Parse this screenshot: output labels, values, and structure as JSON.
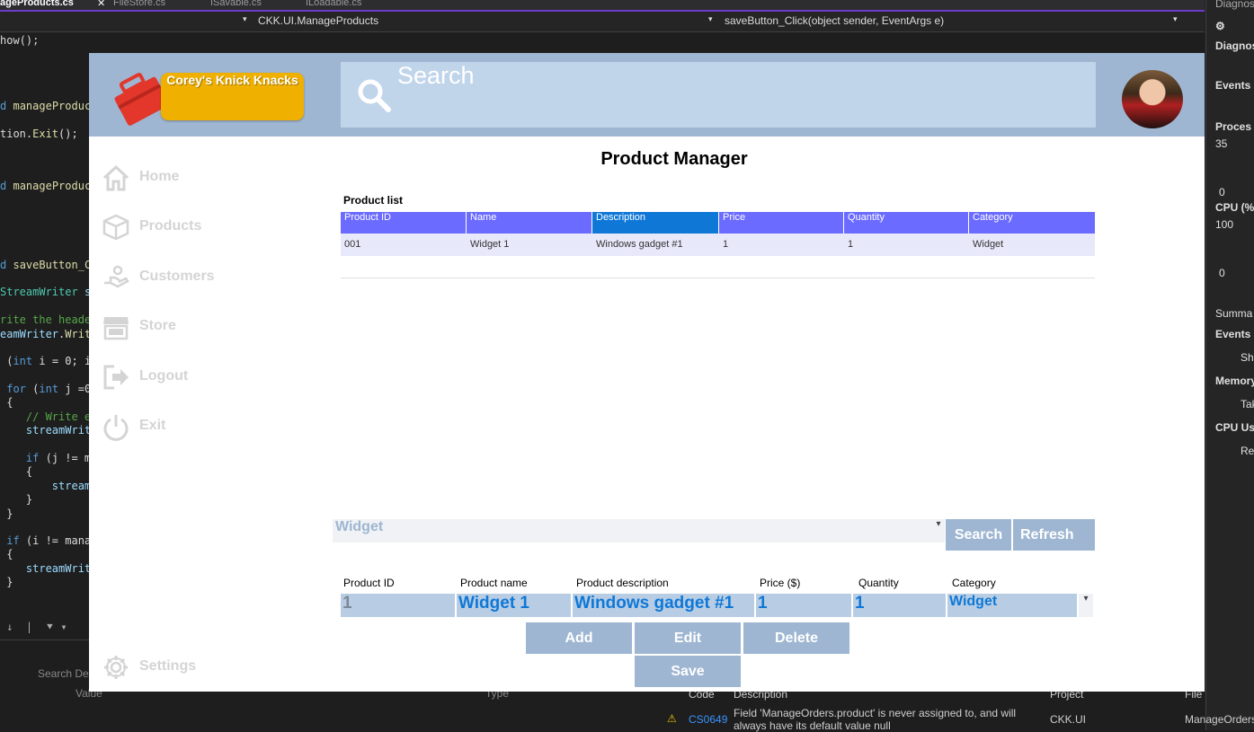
{
  "ide": {
    "tabs": [
      "ageProducts.cs",
      "FileStore.cs",
      "ISavable.cs",
      "ILoadable.cs"
    ],
    "nav_class": "CKK.UI.ManageProducts",
    "nav_member": "saveButton_Click(object sender, EventArgs e)",
    "diag_title": "Diagnost",
    "diag_labels": [
      "Diagnos",
      "Events",
      "Proces",
      "35",
      "0",
      "CPU (%",
      "100",
      "0",
      "Summa",
      "Events",
      "Sho",
      "Memory",
      "Tak",
      "CPU Us",
      "Rec"
    ],
    "bottom": {
      "search": "Search Dep",
      "value_header": "Value",
      "type_header": "Type",
      "code_header": "Code",
      "desc_header": "Description",
      "project_header": "Project",
      "file_header": "File",
      "error_code": "CS0649",
      "error_desc": "Field 'ManageOrders.product' is never assigned to, and will always have its default value null",
      "error_project": "CKK.UI",
      "error_file": "ManageOrders"
    }
  },
  "app": {
    "logo_text": "Corey's Knick Knacks",
    "search_placeholder": "Search",
    "nav": [
      {
        "label": "Home",
        "icon": "home-icon"
      },
      {
        "label": "Products",
        "icon": "box-icon"
      },
      {
        "label": "Customers",
        "icon": "hand-icon"
      },
      {
        "label": "Store",
        "icon": "store-icon"
      },
      {
        "label": "Logout",
        "icon": "logout-icon"
      },
      {
        "label": "Exit",
        "icon": "power-icon"
      }
    ],
    "settings_label": "Settings",
    "title": "Product Manager",
    "list_caption": "Product list",
    "grid_headers": [
      "Product ID",
      "Name",
      "Description",
      "Price",
      "Quantity",
      "Category"
    ],
    "grid_rows": [
      [
        "001",
        "Widget 1",
        "Windows gadget #1",
        "1",
        "1",
        "Widget"
      ]
    ],
    "filter_value": "Widget",
    "search_button": "Search",
    "refresh_button": "Refresh",
    "form_labels": [
      "Product ID",
      "Product name",
      "Product description",
      "Price ($)",
      "Quantity",
      "Category"
    ],
    "form_values": {
      "id": "1",
      "name": "Widget 1",
      "description": "Windows gadget #1",
      "price": "1",
      "quantity": "1",
      "category": "Widget"
    },
    "add_button": "Add",
    "edit_button": "Edit",
    "delete_button": "Delete",
    "save_button": "Save"
  },
  "colors": {
    "topbar": "#9eb6d2",
    "search_bg": "#c0d4ea",
    "grid_header": "#6b6bff",
    "grid_header_selected": "#0f78d7",
    "logo": "#f0b000",
    "accent_text": "#0f78d7"
  }
}
